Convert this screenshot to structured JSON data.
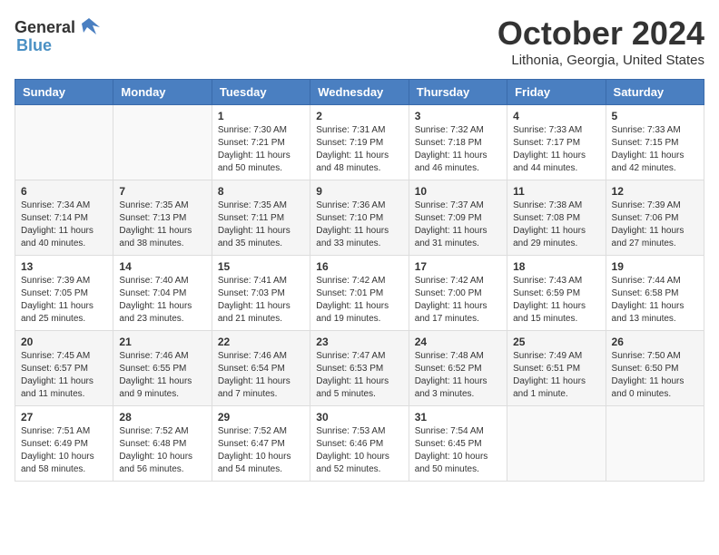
{
  "header": {
    "logo_general": "General",
    "logo_blue": "Blue",
    "month": "October 2024",
    "location": "Lithonia, Georgia, United States"
  },
  "weekdays": [
    "Sunday",
    "Monday",
    "Tuesday",
    "Wednesday",
    "Thursday",
    "Friday",
    "Saturday"
  ],
  "weeks": [
    [
      {
        "day": "",
        "sunrise": "",
        "sunset": "",
        "daylight": ""
      },
      {
        "day": "",
        "sunrise": "",
        "sunset": "",
        "daylight": ""
      },
      {
        "day": "1",
        "sunrise": "Sunrise: 7:30 AM",
        "sunset": "Sunset: 7:21 PM",
        "daylight": "Daylight: 11 hours and 50 minutes."
      },
      {
        "day": "2",
        "sunrise": "Sunrise: 7:31 AM",
        "sunset": "Sunset: 7:19 PM",
        "daylight": "Daylight: 11 hours and 48 minutes."
      },
      {
        "day": "3",
        "sunrise": "Sunrise: 7:32 AM",
        "sunset": "Sunset: 7:18 PM",
        "daylight": "Daylight: 11 hours and 46 minutes."
      },
      {
        "day": "4",
        "sunrise": "Sunrise: 7:33 AM",
        "sunset": "Sunset: 7:17 PM",
        "daylight": "Daylight: 11 hours and 44 minutes."
      },
      {
        "day": "5",
        "sunrise": "Sunrise: 7:33 AM",
        "sunset": "Sunset: 7:15 PM",
        "daylight": "Daylight: 11 hours and 42 minutes."
      }
    ],
    [
      {
        "day": "6",
        "sunrise": "Sunrise: 7:34 AM",
        "sunset": "Sunset: 7:14 PM",
        "daylight": "Daylight: 11 hours and 40 minutes."
      },
      {
        "day": "7",
        "sunrise": "Sunrise: 7:35 AM",
        "sunset": "Sunset: 7:13 PM",
        "daylight": "Daylight: 11 hours and 38 minutes."
      },
      {
        "day": "8",
        "sunrise": "Sunrise: 7:35 AM",
        "sunset": "Sunset: 7:11 PM",
        "daylight": "Daylight: 11 hours and 35 minutes."
      },
      {
        "day": "9",
        "sunrise": "Sunrise: 7:36 AM",
        "sunset": "Sunset: 7:10 PM",
        "daylight": "Daylight: 11 hours and 33 minutes."
      },
      {
        "day": "10",
        "sunrise": "Sunrise: 7:37 AM",
        "sunset": "Sunset: 7:09 PM",
        "daylight": "Daylight: 11 hours and 31 minutes."
      },
      {
        "day": "11",
        "sunrise": "Sunrise: 7:38 AM",
        "sunset": "Sunset: 7:08 PM",
        "daylight": "Daylight: 11 hours and 29 minutes."
      },
      {
        "day": "12",
        "sunrise": "Sunrise: 7:39 AM",
        "sunset": "Sunset: 7:06 PM",
        "daylight": "Daylight: 11 hours and 27 minutes."
      }
    ],
    [
      {
        "day": "13",
        "sunrise": "Sunrise: 7:39 AM",
        "sunset": "Sunset: 7:05 PM",
        "daylight": "Daylight: 11 hours and 25 minutes."
      },
      {
        "day": "14",
        "sunrise": "Sunrise: 7:40 AM",
        "sunset": "Sunset: 7:04 PM",
        "daylight": "Daylight: 11 hours and 23 minutes."
      },
      {
        "day": "15",
        "sunrise": "Sunrise: 7:41 AM",
        "sunset": "Sunset: 7:03 PM",
        "daylight": "Daylight: 11 hours and 21 minutes."
      },
      {
        "day": "16",
        "sunrise": "Sunrise: 7:42 AM",
        "sunset": "Sunset: 7:01 PM",
        "daylight": "Daylight: 11 hours and 19 minutes."
      },
      {
        "day": "17",
        "sunrise": "Sunrise: 7:42 AM",
        "sunset": "Sunset: 7:00 PM",
        "daylight": "Daylight: 11 hours and 17 minutes."
      },
      {
        "day": "18",
        "sunrise": "Sunrise: 7:43 AM",
        "sunset": "Sunset: 6:59 PM",
        "daylight": "Daylight: 11 hours and 15 minutes."
      },
      {
        "day": "19",
        "sunrise": "Sunrise: 7:44 AM",
        "sunset": "Sunset: 6:58 PM",
        "daylight": "Daylight: 11 hours and 13 minutes."
      }
    ],
    [
      {
        "day": "20",
        "sunrise": "Sunrise: 7:45 AM",
        "sunset": "Sunset: 6:57 PM",
        "daylight": "Daylight: 11 hours and 11 minutes."
      },
      {
        "day": "21",
        "sunrise": "Sunrise: 7:46 AM",
        "sunset": "Sunset: 6:55 PM",
        "daylight": "Daylight: 11 hours and 9 minutes."
      },
      {
        "day": "22",
        "sunrise": "Sunrise: 7:46 AM",
        "sunset": "Sunset: 6:54 PM",
        "daylight": "Daylight: 11 hours and 7 minutes."
      },
      {
        "day": "23",
        "sunrise": "Sunrise: 7:47 AM",
        "sunset": "Sunset: 6:53 PM",
        "daylight": "Daylight: 11 hours and 5 minutes."
      },
      {
        "day": "24",
        "sunrise": "Sunrise: 7:48 AM",
        "sunset": "Sunset: 6:52 PM",
        "daylight": "Daylight: 11 hours and 3 minutes."
      },
      {
        "day": "25",
        "sunrise": "Sunrise: 7:49 AM",
        "sunset": "Sunset: 6:51 PM",
        "daylight": "Daylight: 11 hours and 1 minute."
      },
      {
        "day": "26",
        "sunrise": "Sunrise: 7:50 AM",
        "sunset": "Sunset: 6:50 PM",
        "daylight": "Daylight: 11 hours and 0 minutes."
      }
    ],
    [
      {
        "day": "27",
        "sunrise": "Sunrise: 7:51 AM",
        "sunset": "Sunset: 6:49 PM",
        "daylight": "Daylight: 10 hours and 58 minutes."
      },
      {
        "day": "28",
        "sunrise": "Sunrise: 7:52 AM",
        "sunset": "Sunset: 6:48 PM",
        "daylight": "Daylight: 10 hours and 56 minutes."
      },
      {
        "day": "29",
        "sunrise": "Sunrise: 7:52 AM",
        "sunset": "Sunset: 6:47 PM",
        "daylight": "Daylight: 10 hours and 54 minutes."
      },
      {
        "day": "30",
        "sunrise": "Sunrise: 7:53 AM",
        "sunset": "Sunset: 6:46 PM",
        "daylight": "Daylight: 10 hours and 52 minutes."
      },
      {
        "day": "31",
        "sunrise": "Sunrise: 7:54 AM",
        "sunset": "Sunset: 6:45 PM",
        "daylight": "Daylight: 10 hours and 50 minutes."
      },
      {
        "day": "",
        "sunrise": "",
        "sunset": "",
        "daylight": ""
      },
      {
        "day": "",
        "sunrise": "",
        "sunset": "",
        "daylight": ""
      }
    ]
  ]
}
